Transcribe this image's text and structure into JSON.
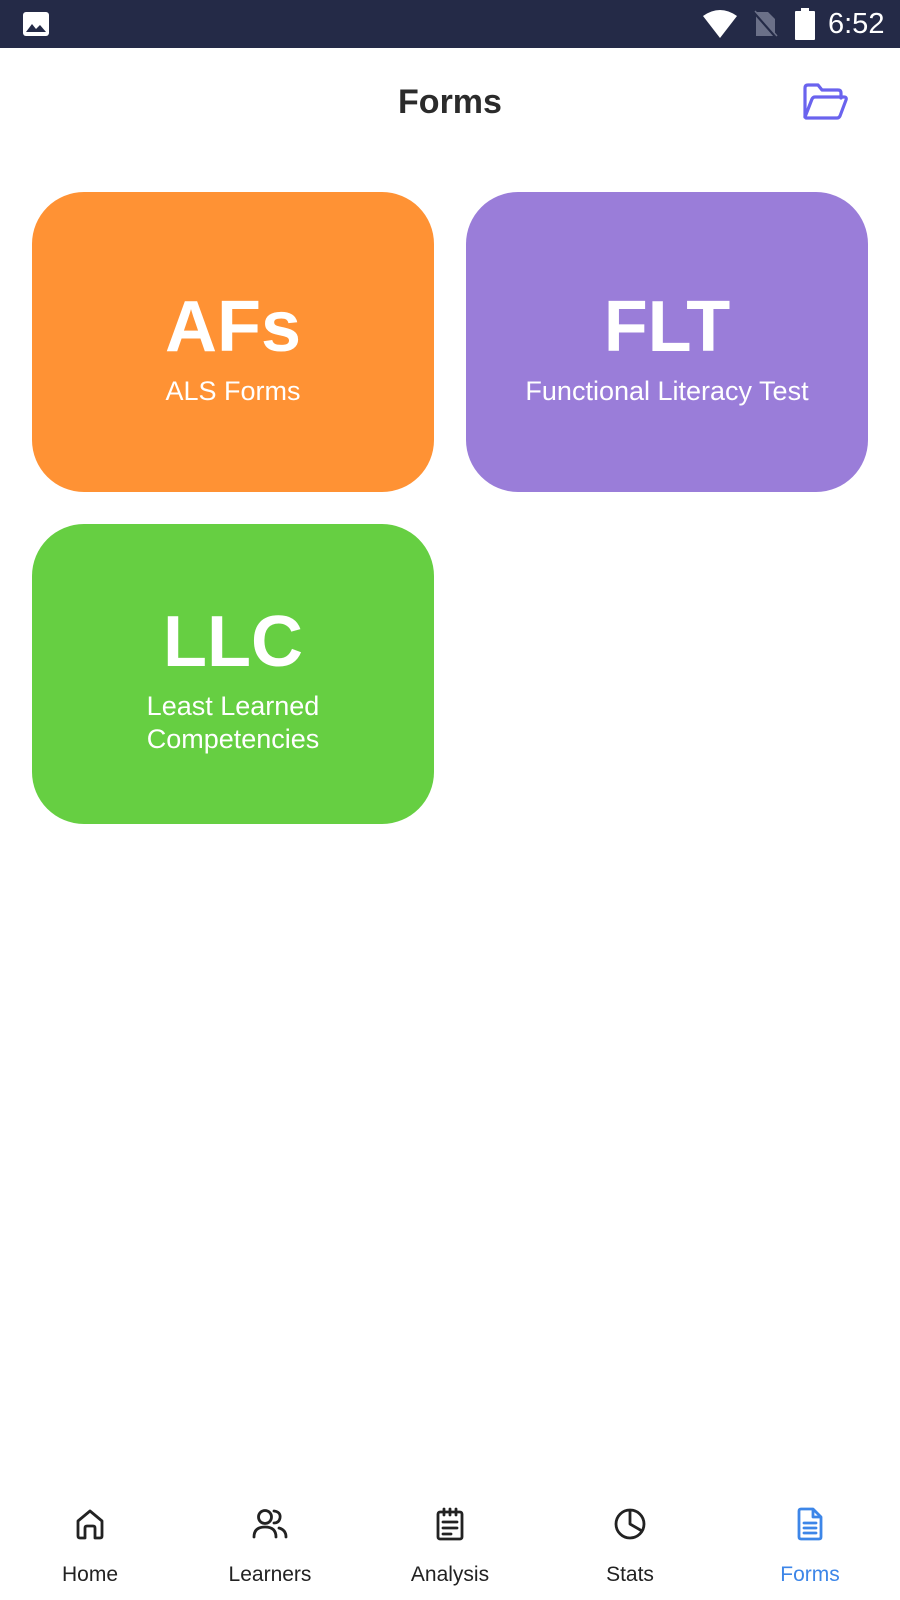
{
  "status_bar": {
    "time": "6:52",
    "icons": [
      "gallery-icon",
      "wifi-icon",
      "no-sim-icon",
      "battery-icon"
    ]
  },
  "header": {
    "title": "Forms",
    "folder_icon": "folder-open-icon"
  },
  "cards": [
    {
      "abbr": "AFs",
      "label": "ALS Forms",
      "color": "#ff9234"
    },
    {
      "abbr": "FLT",
      "label": "Functional Literacy Test",
      "color": "#9a7dd9"
    },
    {
      "abbr": "LLC",
      "label": "Least Learned Competencies",
      "color": "#66cf42"
    }
  ],
  "bottom_nav": {
    "active": "Forms",
    "active_color": "#3d86e8",
    "items": [
      {
        "label": "Home",
        "icon": "home-icon"
      },
      {
        "label": "Learners",
        "icon": "users-icon"
      },
      {
        "label": "Analysis",
        "icon": "clipboard-icon"
      },
      {
        "label": "Stats",
        "icon": "pie-chart-icon"
      },
      {
        "label": "Forms",
        "icon": "document-icon"
      }
    ]
  }
}
